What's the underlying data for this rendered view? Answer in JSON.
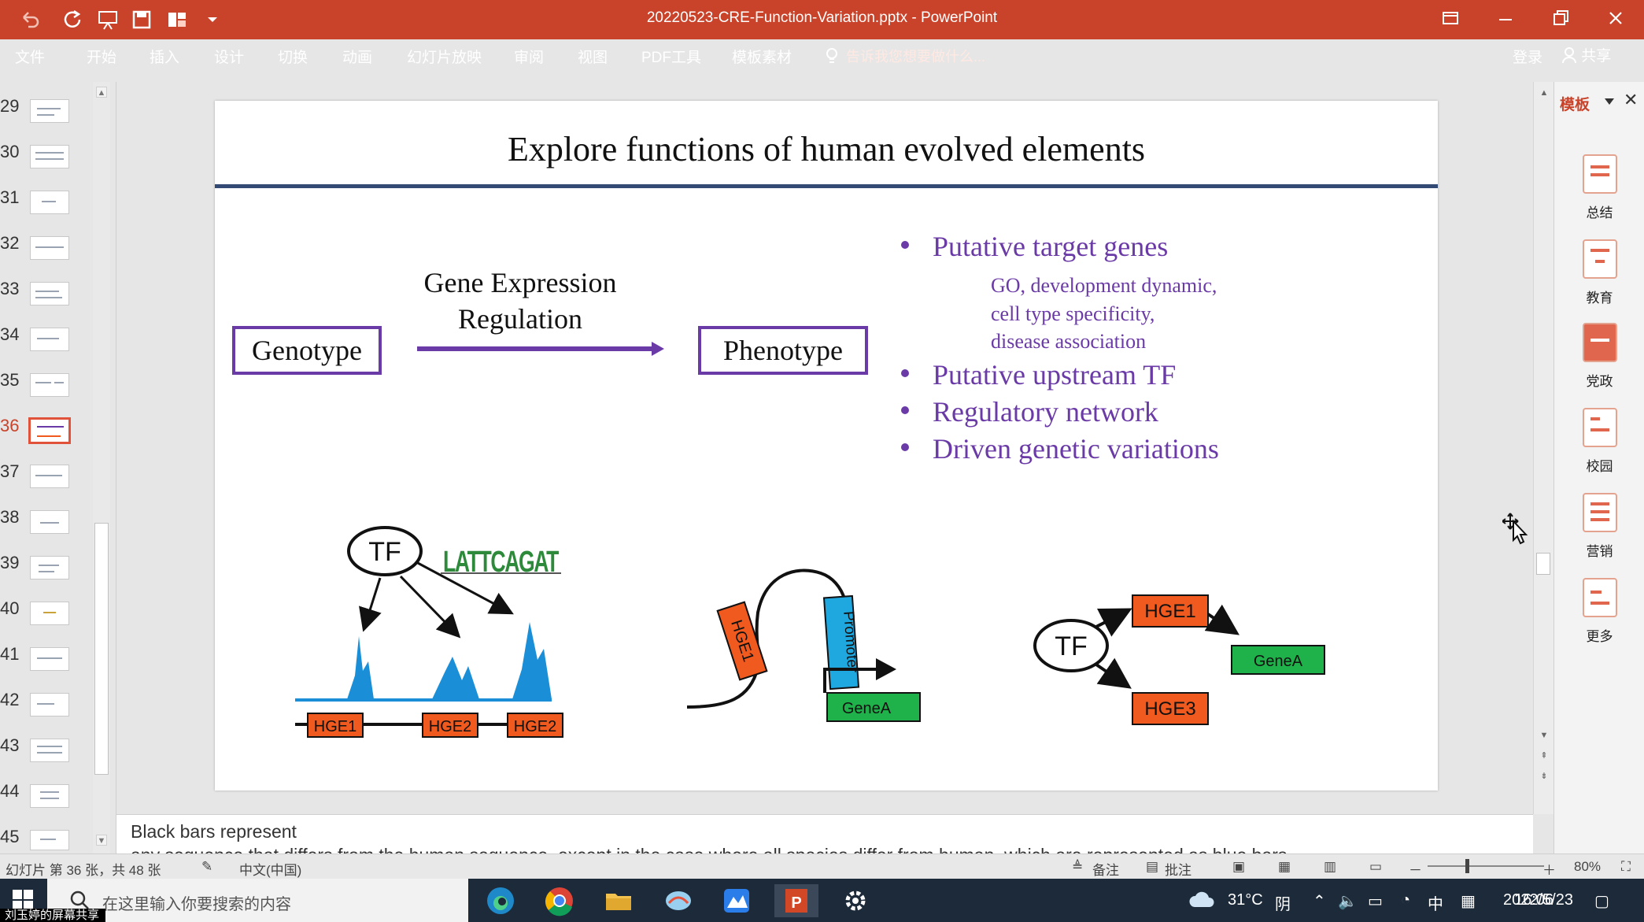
{
  "window": {
    "title": "20220523-CRE-Function-Variation.pptx - PowerPoint"
  },
  "ribbon": {
    "tabs": [
      "文件",
      "开始",
      "插入",
      "设计",
      "切换",
      "动画",
      "幻灯片放映",
      "审阅",
      "视图",
      "PDF工具",
      "模板素材"
    ],
    "tell_me": "告诉我您想要做什么...",
    "login": "登录",
    "share": "共享"
  },
  "thumbnails": {
    "numbers": [
      "29",
      "30",
      "31",
      "32",
      "33",
      "34",
      "35",
      "36",
      "37",
      "38",
      "39",
      "40",
      "41",
      "42",
      "43",
      "44",
      "45"
    ],
    "selected": "36"
  },
  "slide": {
    "title": "Explore functions of human evolved elements",
    "genotype": "Genotype",
    "phenotype": "Phenotype",
    "ger_line1": "Gene Expression",
    "ger_line2": "Regulation",
    "bullets": [
      "Putative target genes",
      "Putative upstream TF",
      "Regulatory network",
      "Driven genetic variations"
    ],
    "sub_lines": [
      "GO, development dynamic,",
      "cell type specificity,",
      "disease association"
    ],
    "diagram1": {
      "tf": "TF",
      "logo": "LATTCAGAT",
      "hge1": "HGE1",
      "hge2a": "HGE2",
      "hge2b": "HGE2"
    },
    "diagram2": {
      "hge1": "HGE1",
      "promoter": "Promoter",
      "genea": "GeneA"
    },
    "diagram3": {
      "tf": "TF",
      "hge1": "HGE1",
      "hge3": "HGE3",
      "genea": "GeneA"
    },
    "colors": {
      "purple": "#6a3aa6",
      "orange": "#f05a1e",
      "green": "#1fb24a",
      "blue": "#1a8fd8",
      "cyan": "#1fa8e0",
      "rule": "#334a75"
    }
  },
  "template_pane": {
    "title": "模板",
    "items": [
      "总结",
      "教育",
      "党政",
      "校园",
      "营销",
      "更多"
    ]
  },
  "notes": {
    "line1": "Black bars represent",
    "line2": "any sequence that differs from the human sequence, except in the case where all species differ from human, which are represented as blue bars."
  },
  "status": {
    "slide_info": "幻灯片 第 36 张，共 48 张",
    "language": "中文(中国)",
    "notes_btn": "备注",
    "comments_btn": "批注",
    "zoom": "80%"
  },
  "taskbar": {
    "search_placeholder": "在这里输入你要搜索的内容",
    "share_label": "刘玉婷的屏幕共享",
    "temp": "31°C",
    "weather": "阴",
    "ime": "中",
    "time": "16:06",
    "date": "2022/5/23"
  }
}
